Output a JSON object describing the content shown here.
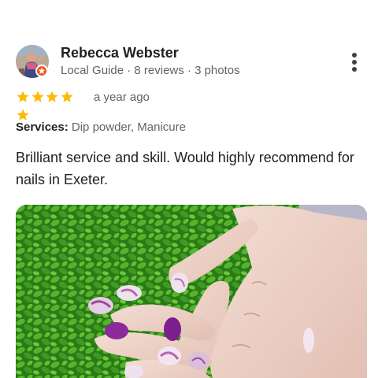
{
  "reviewer": {
    "name": "Rebecca Webster",
    "meta": "Local Guide · 8 reviews · 3 photos",
    "avatar_icon": "profile-photo",
    "badge_icon": "local-guide-star-icon",
    "badge_color": "#f4511e"
  },
  "rating": {
    "stars": 5,
    "max": 5,
    "star_color": "#fbbc04",
    "date": "a year ago"
  },
  "services": {
    "label": "Services:",
    "value": "Dip powder, Manicure"
  },
  "review": {
    "text": "Brilliant service and skill. Would highly recommend for nails in Exeter."
  },
  "photo": {
    "description_icon": "review-photo"
  },
  "actions": {
    "more_icon": "more-vert-icon"
  }
}
